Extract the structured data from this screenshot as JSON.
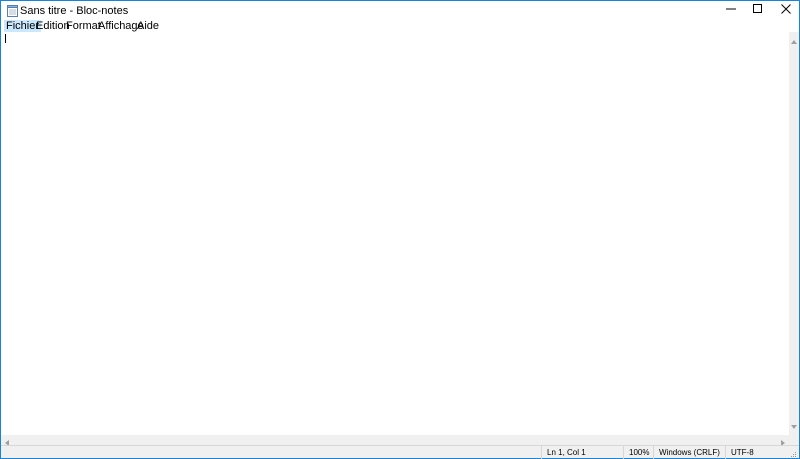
{
  "window": {
    "title": "Sans titre - Bloc-notes"
  },
  "menu": {
    "items": [
      {
        "label": "Fichier"
      },
      {
        "label": "Edition"
      },
      {
        "label": "Format"
      },
      {
        "label": "Affichage"
      },
      {
        "label": "Aide"
      }
    ]
  },
  "editor": {
    "content": ""
  },
  "status": {
    "position": "Ln 1, Col 1",
    "zoom": "100%",
    "line_ending": "Windows (CRLF)",
    "encoding": "UTF-8"
  },
  "colors": {
    "window_border": "#1883d7",
    "menu_active": "#cce8ff",
    "statusbar_bg": "#f0f0f0"
  },
  "icons": {
    "app": "notepad-icon",
    "minimize": "minimize-icon",
    "maximize": "maximize-icon",
    "close": "close-icon"
  }
}
